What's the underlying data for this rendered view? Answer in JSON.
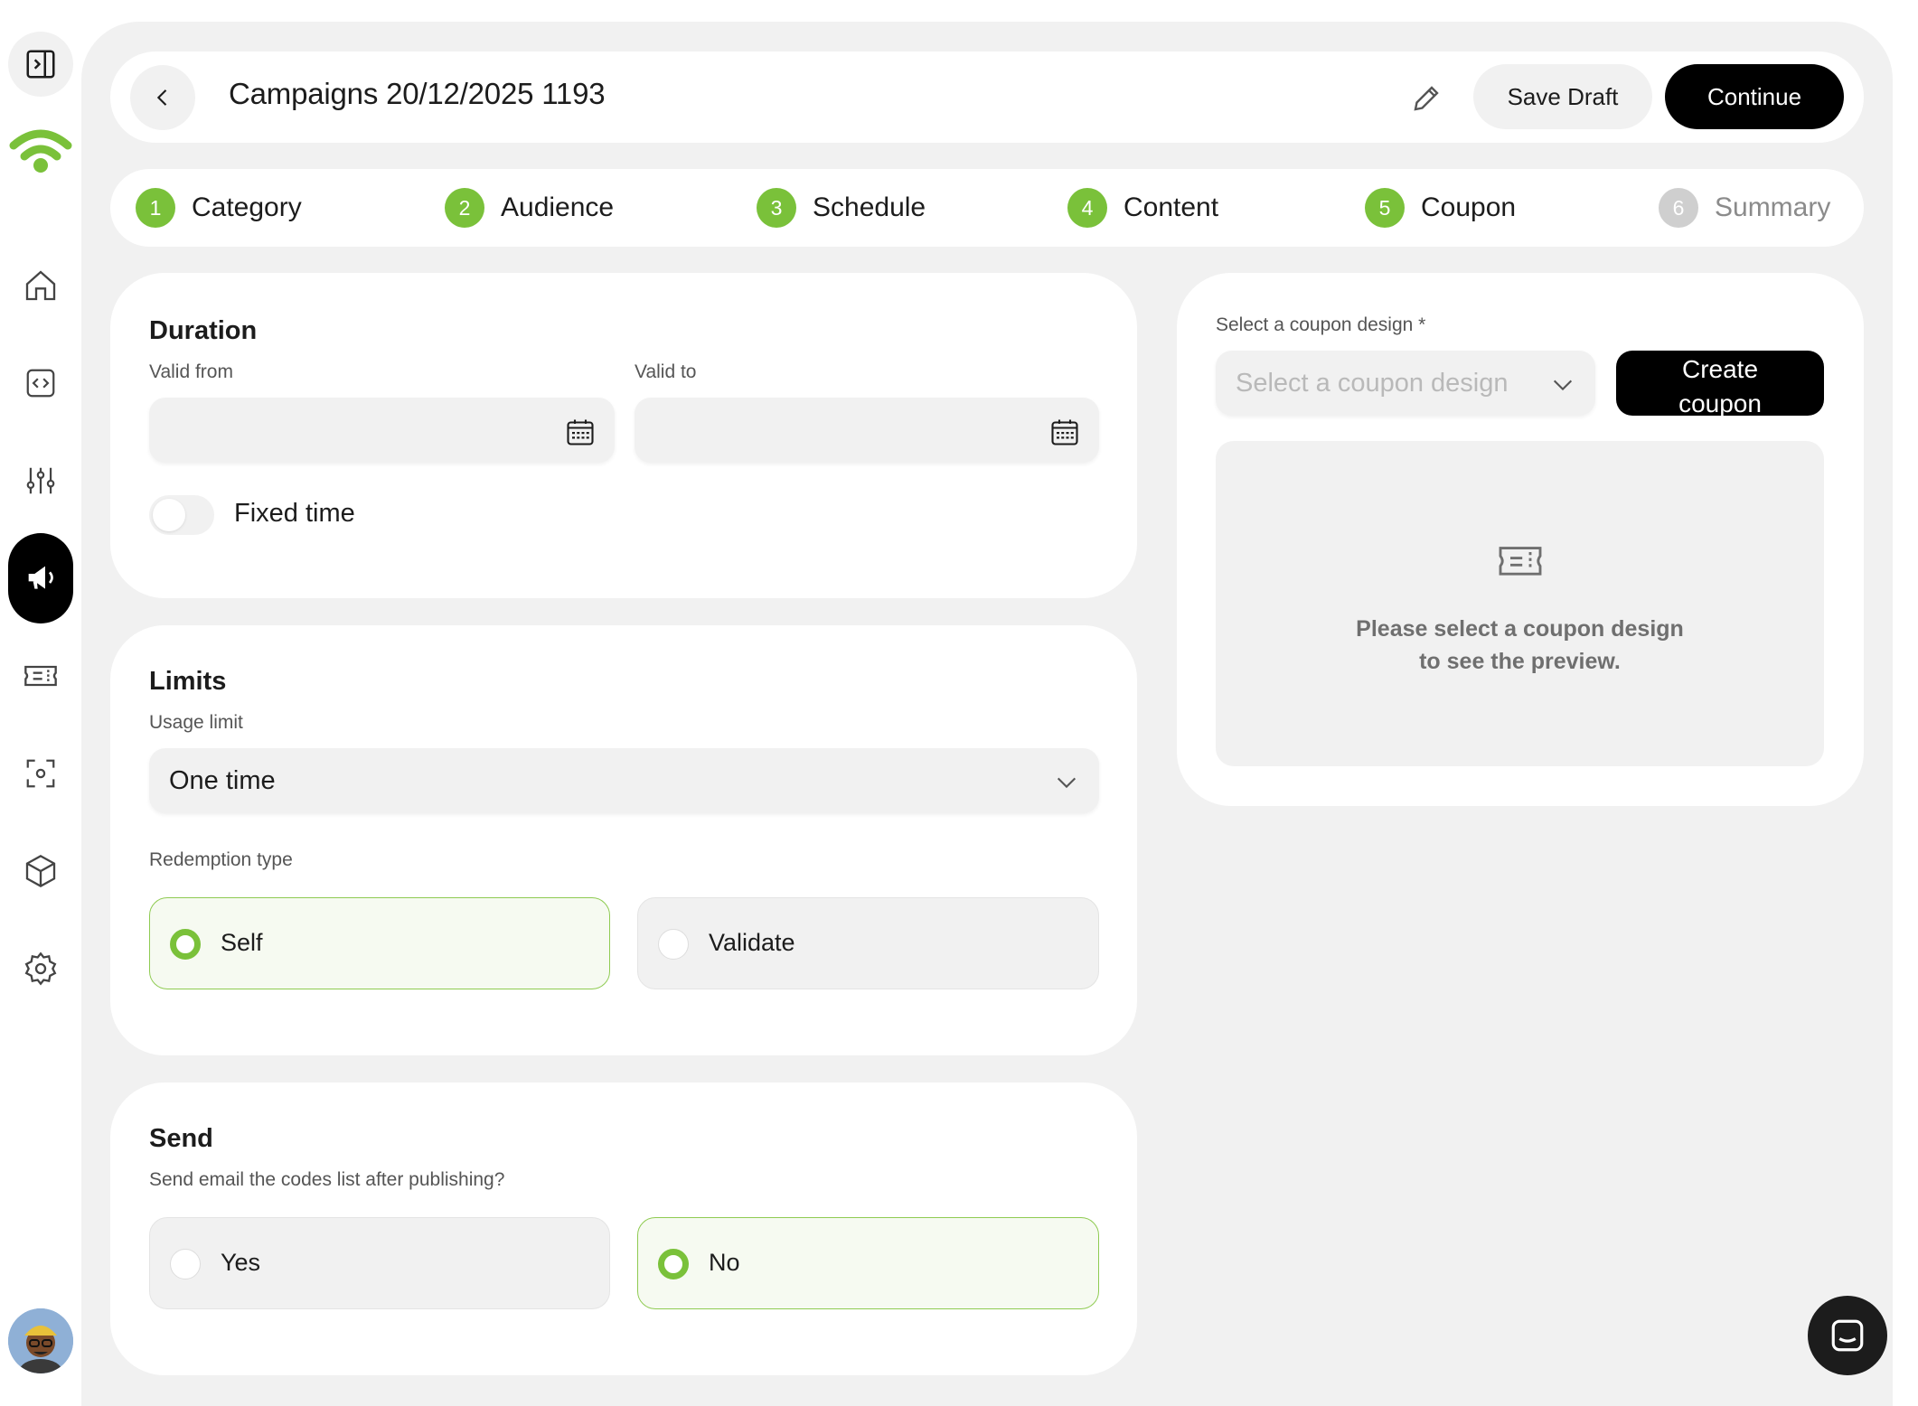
{
  "header": {
    "title": "Campaigns 20/12/2025 1193",
    "save_draft_label": "Save Draft",
    "continue_label": "Continue"
  },
  "steps": [
    {
      "number": "1",
      "label": "Category",
      "status": "complete"
    },
    {
      "number": "2",
      "label": "Audience",
      "status": "complete"
    },
    {
      "number": "3",
      "label": "Schedule",
      "status": "complete"
    },
    {
      "number": "4",
      "label": "Content",
      "status": "complete"
    },
    {
      "number": "5",
      "label": "Coupon",
      "status": "current"
    },
    {
      "number": "6",
      "label": "Summary",
      "status": "pending"
    }
  ],
  "duration": {
    "title": "Duration",
    "valid_from_label": "Valid from",
    "valid_from_value": "",
    "valid_to_label": "Valid to",
    "valid_to_value": "",
    "fixed_time_label": "Fixed time",
    "fixed_time_on": false
  },
  "limits": {
    "title": "Limits",
    "usage_limit_label": "Usage limit",
    "usage_limit_value": "One time",
    "redemption_type_label": "Redemption type",
    "options": [
      {
        "label": "Self",
        "selected": true
      },
      {
        "label": "Validate",
        "selected": false
      }
    ]
  },
  "send": {
    "title": "Send",
    "question": "Send email the codes list after publishing?",
    "options": [
      {
        "label": "Yes",
        "selected": false
      },
      {
        "label": "No",
        "selected": true
      }
    ]
  },
  "coupon": {
    "select_label": "Select a coupon design *",
    "select_placeholder": "Select a coupon design",
    "create_label_line1": "Create",
    "create_label_line2": "coupon",
    "preview_line1": "Please select a coupon design",
    "preview_line2": "to see the preview."
  },
  "colors": {
    "accent": "#7ac13a",
    "background": "#f1f1f1",
    "primary_button": "#000000"
  }
}
